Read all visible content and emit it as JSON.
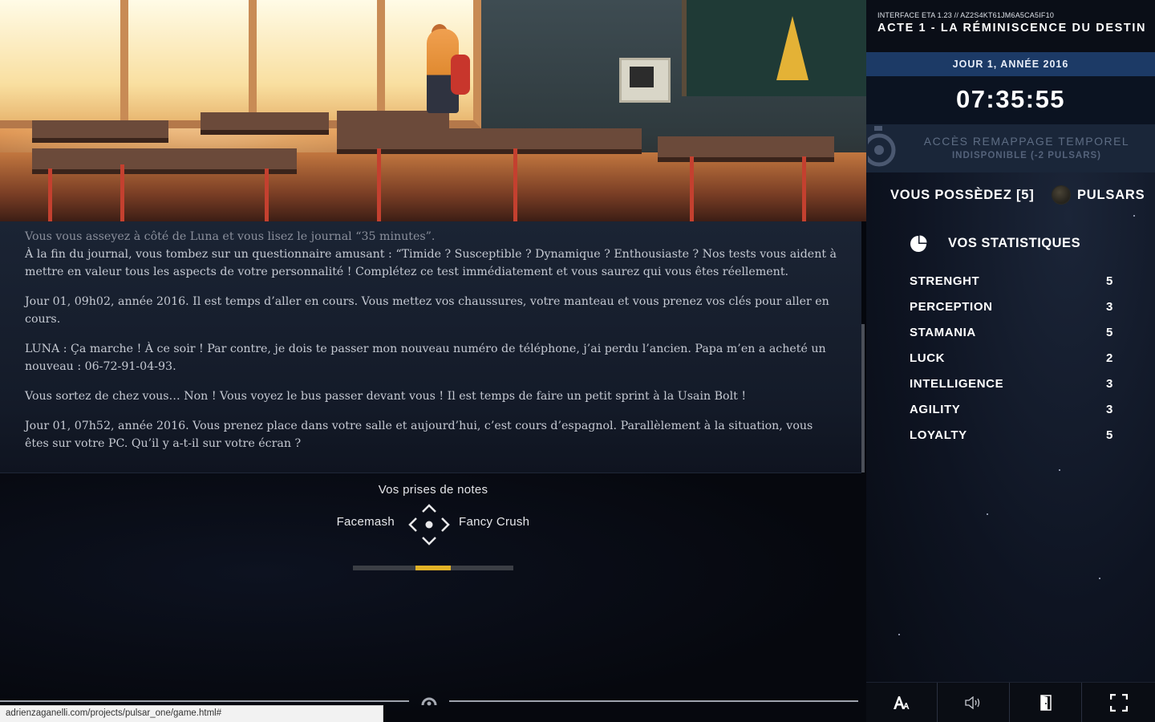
{
  "scene": {
    "description_label": ""
  },
  "story": {
    "paragraphs_faded": "Vous vous asseyez à côté de Luna et vous lisez le journal “35 minutes”.",
    "p1": "À la fin du journal, vous tombez sur un questionnaire amusant : “Timide ? Susceptible ? Dynamique ? Enthousiaste ? Nos tests vous aident à mettre en valeur tous les aspects de votre personnalité ! Complétez ce test immédiatement et vous saurez qui vous êtes réellement.",
    "p2": "Jour 01, 09h02, année 2016. Il est temps d’aller en cours. Vous mettez vos chaussures, votre manteau et vous prenez vos clés pour aller en cours.",
    "p3": "LUNA : Ça marche ! À ce soir ! Par contre, je dois te passer mon nouveau numéro de téléphone, j’ai perdu l’ancien. Papa m’en a acheté un nouveau : 06-72-91-04-93.",
    "p4": "Vous sortez de chez vous… Non ! Vous voyez le bus passer devant vous ! Il est temps de faire un petit sprint à la Usain Bolt !",
    "p5": "Jour 01, 07h52, année 2016. Vous prenez place dans votre salle et aujourd’hui, c’est cours d’espagnol. Parallèlement à la situation, vous êtes sur votre PC. Qu’il y a-t-il sur votre écran ?"
  },
  "notes": {
    "title": "Vos prises de notes",
    "choice_left": "Facemash",
    "choice_right": "Fancy Crush",
    "progress_segment": {
      "start": 0.39,
      "end": 0.61
    },
    "accent": "#e2b227"
  },
  "statusbar": {
    "url": "adrienzaganelli.com/projects/pulsar_one/game.html#"
  },
  "panel": {
    "interface_line": "INTERFACE ETA 1.23 // AZ2S4KT61JM6A5CA5IF10",
    "act_title": "ACTE 1 - LA RÉMINISCENCE DU DESTIN",
    "day": "JOUR 1, ANNÉE 2016",
    "clock": "07:35:55",
    "remap_line1": "ACCÈS REMAPPAGE TEMPOREL",
    "remap_line2": "INDISPONIBLE (-2 PULSARS)",
    "pulsars_own": "VOUS POSSÈDEZ [5]",
    "pulsars_unit": "PULSARS",
    "stats_title": "VOS STATISTIQUES",
    "stats": [
      {
        "name": "STRENGHT",
        "value": "5"
      },
      {
        "name": "PERCEPTION",
        "value": "3"
      },
      {
        "name": "STAMANIA",
        "value": "5"
      },
      {
        "name": "LUCK",
        "value": "2"
      },
      {
        "name": "INTELLIGENCE",
        "value": "3"
      },
      {
        "name": "AGILITY",
        "value": "3"
      },
      {
        "name": "LOYALTY",
        "value": "5"
      }
    ],
    "day_bar_color": "#1c3a66"
  },
  "toolbar": {
    "icons": [
      "font-size-icon",
      "sound-icon",
      "exit-door-icon",
      "fullscreen-icon"
    ]
  }
}
